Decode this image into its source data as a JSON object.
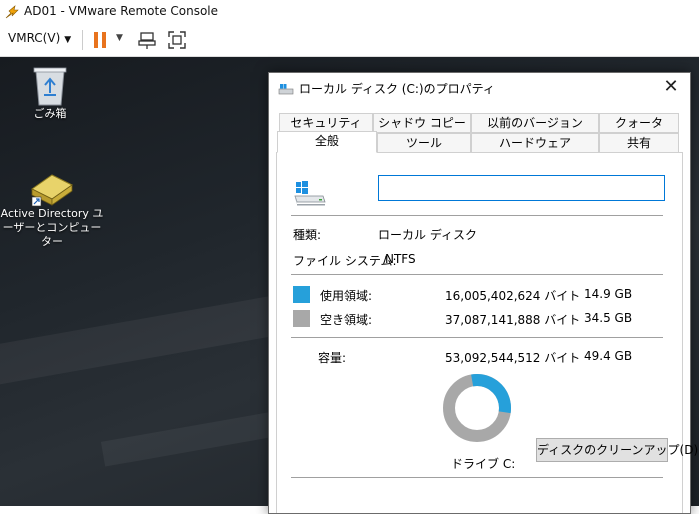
{
  "window": {
    "title": "AD01 - VMware Remote Console"
  },
  "toolbar": {
    "vmrc_menu_label": "VMRC(V)"
  },
  "desktop": {
    "icons": [
      {
        "label": "ごみ箱"
      },
      {
        "label_line1": "Active Directory ユ",
        "label_line2": "ーザーとコンピューター"
      }
    ]
  },
  "dialog": {
    "title": "ローカル ディスク (C:)のプロパティ",
    "tabs_row1": [
      "セキュリティ",
      "シャドウ コピー",
      "以前のバージョン",
      "クォータ"
    ],
    "tabs_row2": [
      "全般",
      "ツール",
      "ハードウェア",
      "共有"
    ],
    "active_tab": "全般",
    "name_value": "",
    "type_label": "種類:",
    "type_value": "ローカル ディスク",
    "fs_label": "ファイル システム:",
    "fs_value": "NTFS",
    "used": {
      "label": "使用領域:",
      "bytes": "16,005,402,624 バイト",
      "size": "14.9 GB",
      "color": "#26a0da"
    },
    "free": {
      "label": "空き領域:",
      "bytes": "37,087,141,888 バイト",
      "size": "34.5 GB",
      "color": "#a8a8a8"
    },
    "capacity": {
      "label": "容量:",
      "bytes": "53,092,544,512 バイト",
      "size": "49.4 GB"
    },
    "used_fraction": 0.3015,
    "drive_label": "ドライブ C:",
    "cleanup_button": "ディスクのクリーンアップ(D)"
  }
}
